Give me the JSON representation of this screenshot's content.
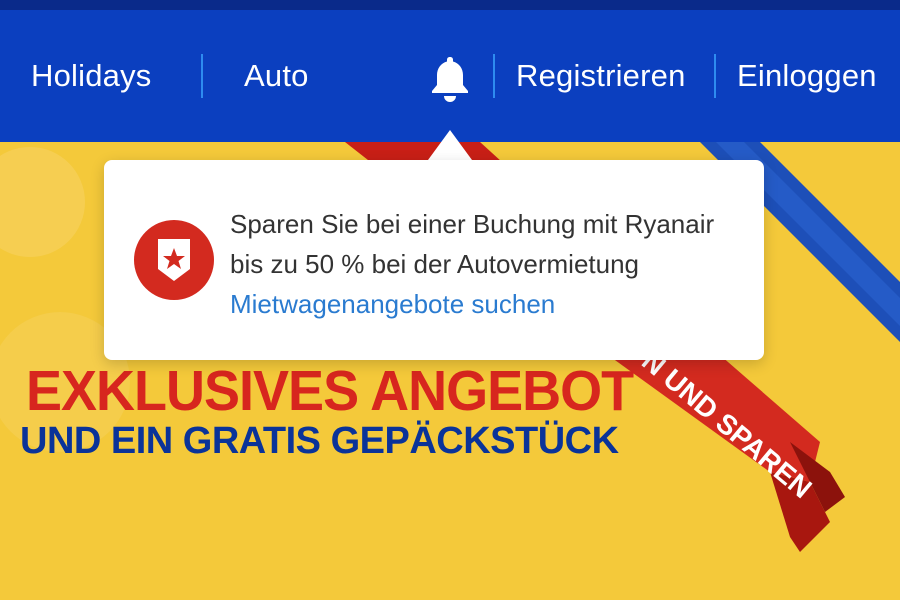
{
  "nav": {
    "items": [
      {
        "label": "Holidays"
      },
      {
        "label": "Auto"
      },
      {
        "label": "Registrieren"
      },
      {
        "label": "Einloggen"
      }
    ],
    "notification_icon": "bell-icon"
  },
  "tooltip": {
    "line1": "Sparen Sie bei einer Buchung mit Ryanair",
    "line2": "bis zu 50 % bei der Autovermietung",
    "link": "Mietwagenangebote suchen",
    "badge_icon": "star-shield-icon"
  },
  "hero": {
    "headline": "EXKLUSIVES ANGEBOT",
    "subheadline": "UND EIN GRATIS GEPÄCKSTÜCK",
    "ribbon_text": "N UND SPAREN"
  },
  "colors": {
    "nav_bg": "#0b3fbf",
    "hero_bg": "#f4c93a",
    "ribbon_red": "#d32a1f",
    "headline_red": "#d7261e",
    "headline_blue": "#0a3399",
    "link_blue": "#2a7bd0"
  }
}
